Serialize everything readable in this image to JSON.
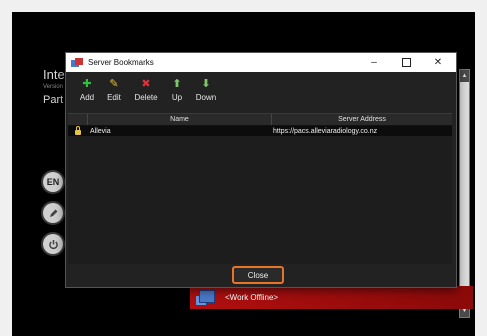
{
  "background_app": {
    "title": "Inte",
    "version_label": "Version",
    "part_label": "Part",
    "side_buttons": [
      {
        "label": "EN",
        "icon": "language-icon"
      },
      {
        "label": "",
        "icon": "pencil-icon"
      },
      {
        "label": "",
        "icon": "power-icon"
      }
    ],
    "offline_text": "<Work Offline>"
  },
  "dialog": {
    "title": "Server Bookmarks",
    "toolbar": [
      {
        "label": "Add",
        "icon": "plus-icon",
        "color": "#2fbf3a"
      },
      {
        "label": "Edit",
        "icon": "pencil-icon",
        "color": "#e5c12c"
      },
      {
        "label": "Delete",
        "icon": "x-icon",
        "color": "#e0303a"
      },
      {
        "label": "Up",
        "icon": "arrow-up-icon",
        "color": "#7ec86a"
      },
      {
        "label": "Down",
        "icon": "arrow-down-icon",
        "color": "#7ec86a"
      }
    ],
    "table": {
      "columns": [
        "",
        "Name",
        "Server Address"
      ],
      "rows": [
        {
          "locked": true,
          "name": "Allevia",
          "address": "https://pacs.alleviaradiology.co.nz"
        }
      ]
    },
    "close_label": "Close"
  },
  "colors": {
    "accent": "#e8742a",
    "offline_bar": "#b01010"
  }
}
